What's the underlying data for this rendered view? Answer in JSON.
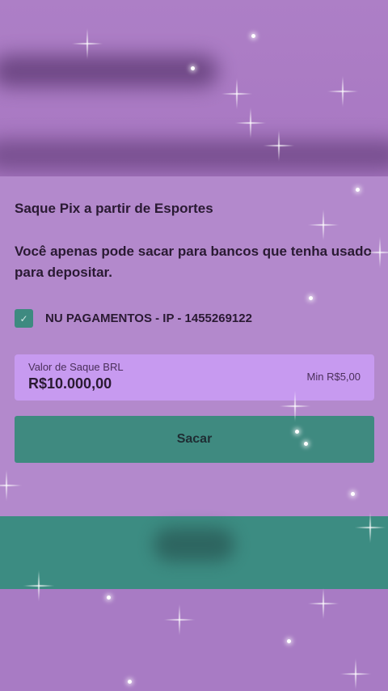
{
  "page": {
    "title": "Saque Pix a partir de Esportes",
    "notice": "Você apenas pode sacar para bancos que tenha usado para depositar."
  },
  "bank": {
    "checked": true,
    "checkmark": "✓",
    "label": "NU PAGAMENTOS - IP - 1455269122"
  },
  "amount": {
    "caption": "Valor de Saque BRL",
    "value": "R$10.000,00",
    "min": "Min R$5,00"
  },
  "actions": {
    "withdraw_label": "Sacar"
  },
  "colors": {
    "background": "#b389cc",
    "accent": "#3f8a80",
    "field": "#c79af0"
  }
}
